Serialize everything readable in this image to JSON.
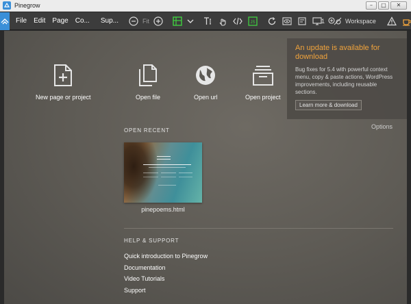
{
  "window": {
    "title": "Pinegrow"
  },
  "menu": {
    "items": [
      "File",
      "Edit",
      "Page",
      "Co...",
      "Sup..."
    ]
  },
  "toolbar": {
    "fit_label": "Fit",
    "device_count": "1",
    "workspace_label": "Workspace"
  },
  "launch": {
    "new_page_label": "New page or project",
    "open_file_label": "Open file",
    "open_url_label": "Open url",
    "open_project_label": "Open project"
  },
  "recent": {
    "heading": "OPEN RECENT",
    "items": [
      {
        "filename": "pinepoems.html"
      }
    ]
  },
  "help": {
    "heading": "HELP & SUPPORT",
    "links": [
      "Quick introduction to Pinegrow",
      "Documentation",
      "Video Tutorials",
      "Support"
    ]
  },
  "update": {
    "heading": "An update is available for download",
    "body": "Bug fixes for 5.4 with powerful context menu, copy & paste actions, WordPress improvements, including reusable sections.",
    "button_label": "Learn more & download"
  },
  "options_label": "Options",
  "colors": {
    "accent": "#f0a33c",
    "logo_bg": "#3a8fd8",
    "toolbar_bg": "#3c3c3c",
    "green_tool": "#3fcf3f"
  }
}
